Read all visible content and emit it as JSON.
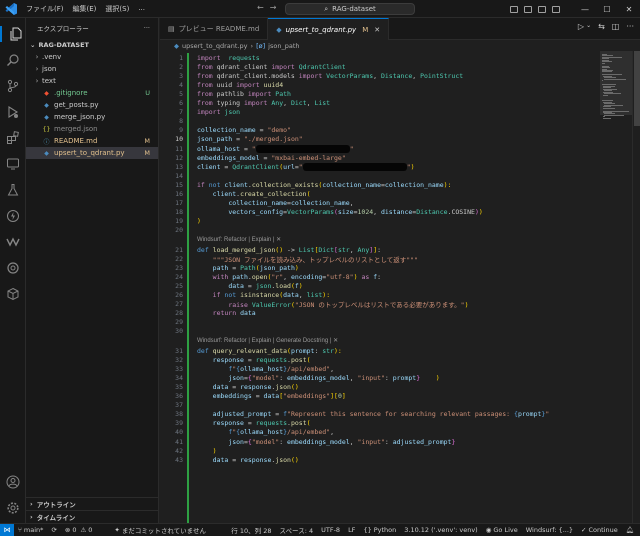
{
  "titlebar": {
    "menu": [
      "ファイル(F)",
      "編集(E)",
      "選択(S)",
      "..."
    ],
    "search": "RAG-dataset"
  },
  "sidebar": {
    "title": "エクスプローラー",
    "root": "RAG-DATASET",
    "items": [
      {
        "label": ".venv",
        "type": "folder",
        "badge": "",
        "color": "#cccccc"
      },
      {
        "label": "json",
        "type": "folder",
        "badge": "",
        "color": "#cccccc"
      },
      {
        "label": "text",
        "type": "folder",
        "badge": "",
        "color": "#cccccc"
      },
      {
        "label": ".gitignore",
        "type": "git",
        "badge": "U",
        "color": "#73c991"
      },
      {
        "label": "get_posts.py",
        "type": "py",
        "badge": "",
        "color": "#cccccc"
      },
      {
        "label": "merge_json.py",
        "type": "py",
        "badge": "",
        "color": "#cccccc"
      },
      {
        "label": "merged.json",
        "type": "json",
        "badge": "",
        "color": "#8b8b8b"
      },
      {
        "label": "README.md",
        "type": "md",
        "badge": "M",
        "color": "#e2c08d"
      },
      {
        "label": "upsert_to_qdrant.py",
        "type": "py",
        "badge": "M",
        "color": "#e2c08d"
      }
    ],
    "outline": "アウトライン",
    "timeline": "タイムライン"
  },
  "tabs": [
    {
      "label": "プレビュー README.md",
      "active": false,
      "mod": ""
    },
    {
      "label": "upsert_to_qdrant.py",
      "active": true,
      "mod": "M"
    }
  ],
  "breadcrumb": {
    "file": "upsert_to_qdrant.py",
    "symbol": "json_path"
  },
  "code": [
    {
      "n": "1",
      "t": [
        [
          "kw",
          "import"
        ],
        [
          "",
          "  "
        ],
        [
          "cl",
          "requests"
        ]
      ]
    },
    {
      "n": "2",
      "t": [
        [
          "kw",
          "from"
        ],
        [
          "",
          " qdrant_client "
        ],
        [
          "kw",
          "import"
        ],
        [
          "",
          " "
        ],
        [
          "cl",
          "QdrantClient"
        ]
      ]
    },
    {
      "n": "3",
      "t": [
        [
          "kw",
          "from"
        ],
        [
          "",
          " qdrant_client.models "
        ],
        [
          "kw",
          "import"
        ],
        [
          "",
          " "
        ],
        [
          "cl",
          "VectorParams"
        ],
        [
          ", "
        ],
        [
          "cl",
          "Distance"
        ],
        [
          ", "
        ],
        [
          "cl",
          "PointStruct"
        ]
      ]
    },
    {
      "n": "4",
      "t": [
        [
          "kw",
          "from"
        ],
        [
          "",
          " uuid "
        ],
        [
          "kw",
          "import"
        ],
        [
          "",
          " "
        ],
        [
          "fn",
          "uuid4"
        ]
      ]
    },
    {
      "n": "5",
      "t": [
        [
          "kw",
          "from"
        ],
        [
          "",
          " pathlib "
        ],
        [
          "kw",
          "import"
        ],
        [
          "",
          " "
        ],
        [
          "cl",
          "Path"
        ]
      ]
    },
    {
      "n": "6",
      "t": [
        [
          "kw",
          "from"
        ],
        [
          "",
          " typing "
        ],
        [
          "kw",
          "import"
        ],
        [
          "",
          " "
        ],
        [
          "cl",
          "Any"
        ],
        [
          ", "
        ],
        [
          "cl",
          "Dict"
        ],
        [
          ", "
        ],
        [
          "cl",
          "List"
        ]
      ]
    },
    {
      "n": "7",
      "t": [
        [
          "kw",
          "import"
        ],
        [
          "",
          " "
        ],
        [
          "cl",
          "json"
        ]
      ]
    },
    {
      "n": "8",
      "t": []
    },
    {
      "n": "9",
      "t": [
        [
          "vr",
          "collection_name"
        ],
        [
          "",
          " = "
        ],
        [
          "st",
          "\"demo\""
        ]
      ]
    },
    {
      "n": "10",
      "t": [
        [
          "vr",
          "json_path"
        ],
        [
          "",
          " = "
        ],
        [
          "st",
          "\"./merged.json\""
        ]
      ],
      "cur": true
    },
    {
      "n": "11",
      "t": [
        [
          "vr",
          "ollama_host"
        ],
        [
          "",
          " = "
        ],
        [
          "st",
          "\""
        ],
        [
          "r",
          "94"
        ],
        [
          "st",
          "\""
        ]
      ]
    },
    {
      "n": "12",
      "t": [
        [
          "vr",
          "embeddings_model"
        ],
        [
          "",
          " = "
        ],
        [
          "st",
          "\"mxbai-embed-large\""
        ]
      ]
    },
    {
      "n": "13",
      "t": [
        [
          "vr",
          "client"
        ],
        [
          "",
          " = "
        ],
        [
          "cl",
          "QdrantClient"
        ],
        [
          "br",
          "("
        ],
        [
          "vr",
          "url"
        ],
        [
          "",
          "="
        ],
        [
          "st",
          "\""
        ],
        [
          "r",
          "104"
        ],
        [
          "st",
          "\""
        ],
        [
          "br",
          ")"
        ]
      ]
    },
    {
      "n": "14",
      "t": []
    },
    {
      "n": "15",
      "t": [
        [
          "kw",
          "if"
        ],
        [
          "",
          " "
        ],
        [
          "kb",
          "not"
        ],
        [
          "",
          " "
        ],
        [
          "vr",
          "client"
        ],
        [
          "",
          "."
        ],
        [
          "fn",
          "collection_exists"
        ],
        [
          "br",
          "("
        ],
        [
          "vr",
          "collection_name"
        ],
        [
          "",
          "="
        ],
        [
          "vr",
          "collection_name"
        ],
        [
          "br",
          "):"
        ]
      ]
    },
    {
      "n": "16",
      "t": [
        [
          "",
          "    "
        ],
        [
          "vr",
          "client"
        ],
        [
          "",
          "."
        ],
        [
          "fn",
          "create_collection"
        ],
        [
          "br",
          "("
        ]
      ]
    },
    {
      "n": "17",
      "t": [
        [
          "",
          "        "
        ],
        [
          "vr",
          "collection_name"
        ],
        [
          "",
          "="
        ],
        [
          "vr",
          "collection_name"
        ],
        [
          ","
        ]
      ]
    },
    {
      "n": "18",
      "t": [
        [
          "",
          "        "
        ],
        [
          "vr",
          "vectors_config"
        ],
        [
          "",
          "="
        ],
        [
          "cl",
          "VectorParams"
        ],
        [
          "bp",
          "("
        ],
        [
          "vr",
          "size"
        ],
        [
          "",
          "="
        ],
        [
          "nm",
          "1024"
        ],
        [
          ", "
        ],
        [
          "vr",
          "distance"
        ],
        [
          "",
          "="
        ],
        [
          "cl",
          "Distance"
        ],
        [
          "",
          ".COSINE"
        ],
        [
          "bp",
          ")"
        ],
        [
          "br",
          ")"
        ]
      ]
    },
    {
      "n": "19",
      "t": [
        [
          "br",
          ")"
        ]
      ]
    },
    {
      "n": "20",
      "t": []
    },
    {
      "lens": "Windsurf: Refactor | Explain | ✕"
    },
    {
      "n": "21",
      "t": [
        [
          "kb",
          "def"
        ],
        [
          "",
          " "
        ],
        [
          "fn",
          "load_merged_json"
        ],
        [
          "br",
          "()"
        ],
        [
          "",
          " -> "
        ],
        [
          "cl",
          "List"
        ],
        [
          "br",
          "["
        ],
        [
          "cl",
          "Dict"
        ],
        [
          "bp",
          "["
        ],
        [
          "cl",
          "str"
        ],
        [
          ", "
        ],
        [
          "cl",
          "Any"
        ],
        [
          "bp",
          "]"
        ],
        [
          "br",
          "]"
        ],
        [
          ":"
        ]
      ]
    },
    {
      "n": "22",
      "t": [
        [
          "",
          "    "
        ],
        [
          "st",
          "\"\"\"JSON ファイルを読み込み、トップレベルのリストとして返す\"\"\""
        ]
      ]
    },
    {
      "n": "23",
      "t": [
        [
          "",
          "    "
        ],
        [
          "vr",
          "path"
        ],
        [
          "",
          " = "
        ],
        [
          "cl",
          "Path"
        ],
        [
          "br",
          "("
        ],
        [
          "vr",
          "json_path"
        ],
        [
          "br",
          ")"
        ]
      ]
    },
    {
      "n": "24",
      "t": [
        [
          "",
          "    "
        ],
        [
          "kw",
          "with"
        ],
        [
          "",
          " "
        ],
        [
          "vr",
          "path"
        ],
        [
          "",
          "."
        ],
        [
          "fn",
          "open"
        ],
        [
          "br",
          "("
        ],
        [
          "st",
          "\"r\""
        ],
        [
          ", "
        ],
        [
          "vr",
          "encoding"
        ],
        [
          "",
          "="
        ],
        [
          "st",
          "\"utf-8\""
        ],
        [
          "br",
          ")"
        ],
        [
          "",
          " "
        ],
        [
          "kw",
          "as"
        ],
        [
          "",
          " "
        ],
        [
          "vr",
          "f"
        ],
        [
          ":"
        ]
      ]
    },
    {
      "n": "25",
      "t": [
        [
          "",
          "        "
        ],
        [
          "vr",
          "data"
        ],
        [
          "",
          " = "
        ],
        [
          "cl",
          "json"
        ],
        [
          "",
          "."
        ],
        [
          "fn",
          "load"
        ],
        [
          "br",
          "("
        ],
        [
          "vr",
          "f"
        ],
        [
          "br",
          ")"
        ]
      ]
    },
    {
      "n": "26",
      "t": [
        [
          "",
          "    "
        ],
        [
          "kw",
          "if"
        ],
        [
          "",
          " "
        ],
        [
          "kb",
          "not"
        ],
        [
          "",
          " "
        ],
        [
          "fn",
          "isinstance"
        ],
        [
          "br",
          "("
        ],
        [
          "vr",
          "data"
        ],
        [
          ", "
        ],
        [
          "cl",
          "list"
        ],
        [
          "br",
          "):"
        ]
      ]
    },
    {
      "n": "27",
      "t": [
        [
          "",
          "        "
        ],
        [
          "kw",
          "raise"
        ],
        [
          "",
          " "
        ],
        [
          "cl",
          "ValueError"
        ],
        [
          "br",
          "("
        ],
        [
          "st",
          "\"JSON のトップレベルはリストである必要があります。\""
        ],
        [
          "br",
          ")"
        ]
      ]
    },
    {
      "n": "28",
      "t": [
        [
          "",
          "    "
        ],
        [
          "kw",
          "return"
        ],
        [
          "",
          " "
        ],
        [
          "vr",
          "data"
        ]
      ]
    },
    {
      "n": "29",
      "t": []
    },
    {
      "n": "30",
      "t": []
    },
    {
      "lens": "Windsurf: Refactor | Explain | Generate Docstring | ✕"
    },
    {
      "n": "31",
      "t": [
        [
          "kb",
          "def"
        ],
        [
          "",
          " "
        ],
        [
          "fn",
          "query_relevant_data"
        ],
        [
          "br",
          "("
        ],
        [
          "vr",
          "prompt"
        ],
        [
          ": "
        ],
        [
          "cl",
          "str"
        ],
        [
          "br",
          "):"
        ]
      ]
    },
    {
      "n": "32",
      "t": [
        [
          "",
          "    "
        ],
        [
          "vr",
          "response"
        ],
        [
          "",
          " = "
        ],
        [
          "cl",
          "requests"
        ],
        [
          "",
          "."
        ],
        [
          "fn",
          "post"
        ],
        [
          "br",
          "("
        ]
      ]
    },
    {
      "n": "33",
      "t": [
        [
          "",
          "        "
        ],
        [
          "kb",
          "f"
        ],
        [
          "st",
          "\""
        ],
        [
          "kb",
          "{"
        ],
        [
          "vr",
          "ollama_host"
        ],
        [
          "kb",
          "}"
        ],
        [
          "st",
          "/api/embed\""
        ],
        [
          ","
        ]
      ]
    },
    {
      "n": "34",
      "t": [
        [
          "",
          "        "
        ],
        [
          "vr",
          "json"
        ],
        [
          "",
          "="
        ],
        [
          "bp",
          "{"
        ],
        [
          "st",
          "\"model\""
        ],
        [
          ": "
        ],
        [
          "vr",
          "embeddings_model"
        ],
        [
          ", "
        ],
        [
          "st",
          "\"input\""
        ],
        [
          ": "
        ],
        [
          "vr",
          "prompt"
        ],
        [
          "bp",
          "}"
        ],
        [
          "",
          "    "
        ],
        [
          "br",
          ")"
        ]
      ]
    },
    {
      "n": "35",
      "t": [
        [
          "",
          "    "
        ],
        [
          "vr",
          "data"
        ],
        [
          "",
          " = "
        ],
        [
          "vr",
          "response"
        ],
        [
          "",
          "."
        ],
        [
          "fn",
          "json"
        ],
        [
          "br",
          "()"
        ]
      ]
    },
    {
      "n": "36",
      "t": [
        [
          "",
          "    "
        ],
        [
          "vr",
          "embeddings"
        ],
        [
          "",
          " = "
        ],
        [
          "vr",
          "data"
        ],
        [
          "br",
          "["
        ],
        [
          "st",
          "\"embeddings\""
        ],
        [
          "br",
          "]"
        ],
        [
          "br",
          "["
        ],
        [
          "nm",
          "0"
        ],
        [
          "br",
          "]"
        ]
      ]
    },
    {
      "n": "37",
      "t": []
    },
    {
      "n": "38",
      "t": [
        [
          "",
          "    "
        ],
        [
          "vr",
          "adjusted_prompt"
        ],
        [
          "",
          " = "
        ],
        [
          "kb",
          "f"
        ],
        [
          "st",
          "\"Represent this sentence for searching relevant passages: "
        ],
        [
          "kb",
          "{"
        ],
        [
          "vr",
          "prompt"
        ],
        [
          "kb",
          "}"
        ],
        [
          "st",
          "\""
        ]
      ]
    },
    {
      "n": "39",
      "t": [
        [
          "",
          "    "
        ],
        [
          "vr",
          "response"
        ],
        [
          "",
          " = "
        ],
        [
          "cl",
          "requests"
        ],
        [
          "",
          "."
        ],
        [
          "fn",
          "post"
        ],
        [
          "br",
          "("
        ]
      ]
    },
    {
      "n": "40",
      "t": [
        [
          "",
          "        "
        ],
        [
          "kb",
          "f"
        ],
        [
          "st",
          "\""
        ],
        [
          "kb",
          "{"
        ],
        [
          "vr",
          "ollama_host"
        ],
        [
          "kb",
          "}"
        ],
        [
          "st",
          "/api/embed\""
        ],
        [
          ","
        ]
      ]
    },
    {
      "n": "41",
      "t": [
        [
          "",
          "        "
        ],
        [
          "vr",
          "json"
        ],
        [
          "",
          "="
        ],
        [
          "bp",
          "{"
        ],
        [
          "st",
          "\"model\""
        ],
        [
          ": "
        ],
        [
          "vr",
          "embeddings_model"
        ],
        [
          ", "
        ],
        [
          "st",
          "\"input\""
        ],
        [
          ": "
        ],
        [
          "vr",
          "adjusted_prompt"
        ],
        [
          "bp",
          "}"
        ]
      ]
    },
    {
      "n": "42",
      "t": [
        [
          "",
          "    "
        ],
        [
          "br",
          ")"
        ]
      ]
    },
    {
      "n": "43",
      "t": [
        [
          "",
          "    "
        ],
        [
          "vr",
          "data"
        ],
        [
          "",
          " = "
        ],
        [
          "vr",
          "response"
        ],
        [
          "",
          "."
        ],
        [
          "fn",
          "json"
        ],
        [
          "br",
          "()"
        ]
      ]
    }
  ],
  "statusbar": {
    "branch": "main*",
    "sync": "⟳",
    "errors": "0",
    "warnings": "0",
    "uncommitted": "まだコミットされていません",
    "position": "行 10、列 28",
    "spaces": "スペース: 4",
    "encoding": "UTF-8",
    "eol": "LF",
    "language": "Python",
    "interpreter": "3.10.12 ('.venv': venv)",
    "golive": "Go Live",
    "windsurf": "Windsurf: {...}",
    "continue": "Continue"
  }
}
